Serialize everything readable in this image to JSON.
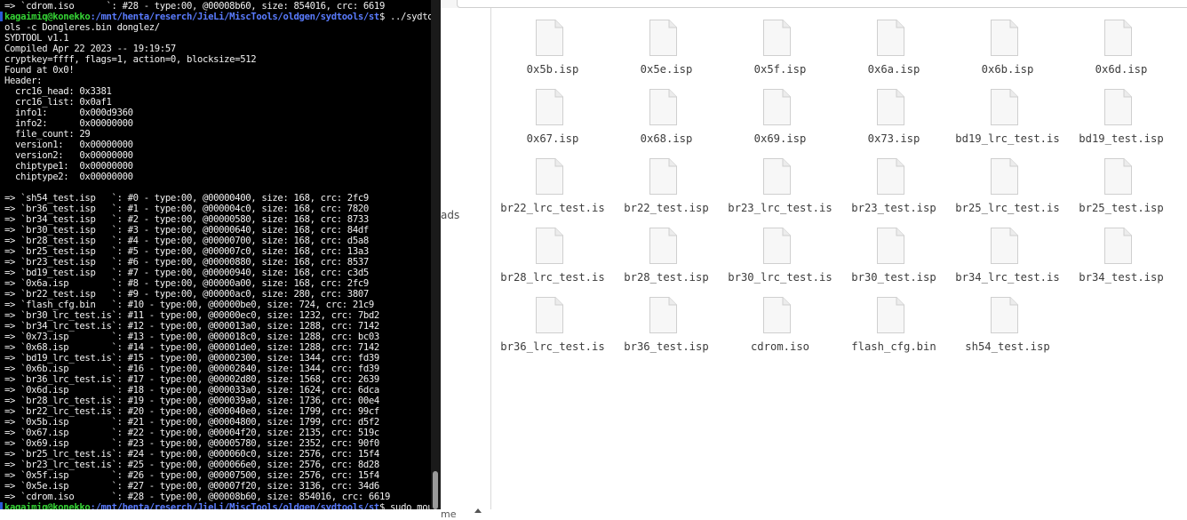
{
  "terminal": {
    "lines": [
      "=> `cdrom.iso      `: #28 - type:00, @00008b60, size: 854016, crc: 6619",
      "",
      "ols -c Dongleres.bin donglez/",
      "SYDTOOL v1.1",
      "Compiled Apr 22 2023 -- 19:19:57",
      "cryptkey=ffff, flags=1, action=0, blocksize=512",
      "Found at 0x0!",
      "Header:",
      "  crc16_head: 0x3381",
      "  crc16_list: 0x0af1",
      "  info1:      0x000d9360",
      "  info2:      0x00000000",
      "  file_count: 29",
      "  version1:   0x00000000",
      "  version2:   0x00000000",
      "  chiptype1:  0x00000000",
      "  chiptype2:  0x00000000",
      "",
      "=> `sh54_test.isp   `: #0 - type:00, @00000400, size: 168, crc: 2fc9",
      "=> `br36_test.isp   `: #1 - type:00, @000004c0, size: 168, crc: 7820",
      "=> `br34_test.isp   `: #2 - type:00, @00000580, size: 168, crc: 8733",
      "=> `br30_test.isp   `: #3 - type:00, @00000640, size: 168, crc: 84df",
      "=> `br28_test.isp   `: #4 - type:00, @00000700, size: 168, crc: d5a8",
      "=> `br25_test.isp   `: #5 - type:00, @000007c0, size: 168, crc: 13a3",
      "=> `br23_test.isp   `: #6 - type:00, @00000880, size: 168, crc: 8537",
      "=> `bd19_test.isp   `: #7 - type:00, @00000940, size: 168, crc: c3d5",
      "=> `0x6a.isp        `: #8 - type:00, @00000a00, size: 168, crc: 2fc9",
      "=> `br22_test.isp   `: #9 - type:00, @00000ac0, size: 280, crc: 3807",
      "=> `flash_cfg.bin   `: #10 - type:00, @00000be0, size: 724, crc: 21c9",
      "=> `br30_lrc_test.is`: #11 - type:00, @00000ec0, size: 1232, crc: 7bd2",
      "=> `br34_lrc_test.is`: #12 - type:00, @000013a0, size: 1288, crc: 7142",
      "=> `0x73.isp        `: #13 - type:00, @000018c0, size: 1288, crc: bc03",
      "=> `0x68.isp        `: #14 - type:00, @00001de0, size: 1288, crc: 7142",
      "=> `bd19_lrc_test.is`: #15 - type:00, @00002300, size: 1344, crc: fd39",
      "=> `0x6b.isp        `: #16 - type:00, @00002840, size: 1344, crc: fd39",
      "=> `br36_lrc_test.is`: #17 - type:00, @00002d80, size: 1568, crc: 2639",
      "=> `0x6d.isp        `: #18 - type:00, @000033a0, size: 1624, crc: 6dca",
      "=> `br28_lrc_test.is`: #19 - type:00, @000039a0, size: 1736, crc: 00e4",
      "=> `br22_lrc_test.is`: #20 - type:00, @000040e0, size: 1799, crc: 99cf",
      "=> `0x5b.isp        `: #21 - type:00, @00004800, size: 1799, crc: d5f2",
      "=> `0x67.isp        `: #22 - type:00, @00004f20, size: 2135, crc: 519c",
      "=> `0x69.isp        `: #23 - type:00, @00005780, size: 2352, crc: 90f0",
      "=> `br25_lrc_test.is`: #24 - type:00, @000060c0, size: 2576, crc: 15f4",
      "=> `br23_lrc_test.is`: #25 - type:00, @000066e0, size: 2576, crc: 8d28",
      "=> `0x5f.isp        `: #26 - type:00, @00007500, size: 2576, crc: 15f4",
      "=> `0x5e.isp        `: #27 - type:00, @00007f20, size: 3136, crc: 34d6",
      "=> `cdrom.iso       `: #28 - type:00, @00008b60, size: 854016, crc: 6619",
      ""
    ],
    "prompt1": {
      "user": "kagaimiq@konekko",
      "path": ":/mnt/henta/reserch/JieLi/MiscTools/oldgen/sydtools/st",
      "command": "$ ../sydto"
    },
    "prompt2": {
      "user": "kagaimiq@konekko",
      "path": ":/mnt/henta/reserch/JieLi/MiscTools/oldgen/sydtools/st",
      "command": "$ sudo mou"
    }
  },
  "file_manager": {
    "sidebar_label": "ads",
    "sidebar_bottom_text": "me",
    "files": [
      "0x5b.isp",
      "0x5e.isp",
      "0x5f.isp",
      "0x6a.isp",
      "0x6b.isp",
      "0x6d.isp",
      "0x67.isp",
      "0x68.isp",
      "0x69.isp",
      "0x73.isp",
      "bd19_lrc_test.is",
      "bd19_test.isp",
      "br22_lrc_test.is",
      "br22_test.isp",
      "br23_lrc_test.is",
      "br23_test.isp",
      "br25_lrc_test.is",
      "br25_test.isp",
      "br28_lrc_test.is",
      "br28_test.isp",
      "br30_lrc_test.is",
      "br30_test.isp",
      "br34_lrc_test.is",
      "br34_test.isp",
      "br36_lrc_test.is",
      "br36_test.isp",
      "cdrom.iso",
      "flash_cfg.bin",
      "sh54_test.isp"
    ],
    "file_icon": "document-icon"
  }
}
